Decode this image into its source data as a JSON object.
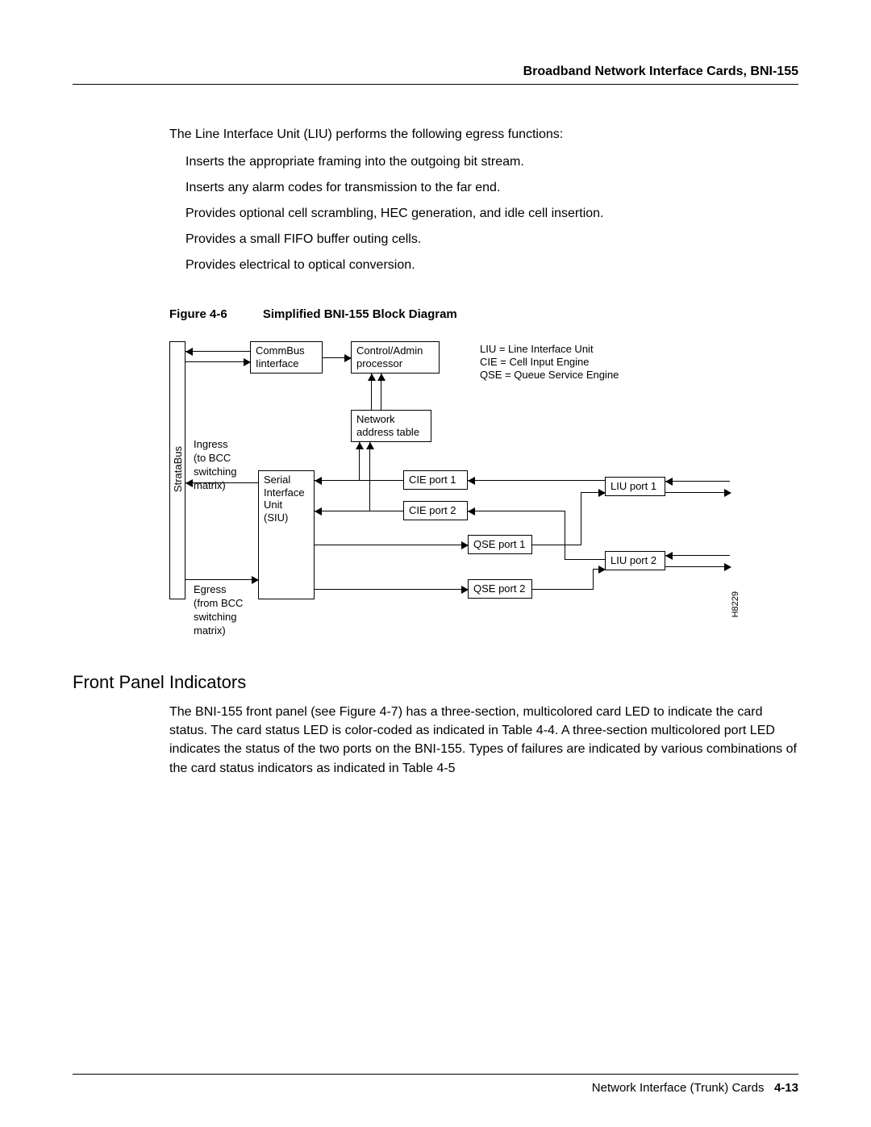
{
  "header": {
    "title": "Broadband Network Interface Cards, BNI-155"
  },
  "intro": "The Line Interface Unit (LIU) performs the following egress functions:",
  "bullets": [
    "Inserts the appropriate framing into the outgoing bit stream.",
    "Inserts any alarm codes for transmission to the far end.",
    "Provides optional cell scrambling, HEC generation, and idle cell insertion.",
    "Provides a small FIFO buffer outing cells.",
    "Provides electrical to optical conversion."
  ],
  "figure": {
    "number": "Figure 4-6",
    "title": "Simplified BNI-155 Block Diagram"
  },
  "diagram": {
    "stratabus": "StrataBus",
    "commbus": "CommBus\nIinterface",
    "control": "Control/Admin\nprocessor",
    "nat": "Network\naddress table",
    "siu": "Serial\nInterface\nUnit\n(SIU)",
    "cie1": "CIE port 1",
    "cie2": "CIE port 2",
    "qse1": "QSE port 1",
    "qse2": "QSE port 2",
    "liu1": "LIU port 1",
    "liu2": "LIU port 2",
    "ingress": "Ingress\n(to BCC\nswitching\nmatrix)",
    "egress": "Egress\n(from BCC\nswitching\nmatrix)",
    "legend1": "LIU = Line Interface Unit",
    "legend2": "CIE = Cell Input Engine",
    "legend3": "QSE = Queue Service Engine",
    "code": "H8229"
  },
  "section": {
    "heading": "Front Panel Indicators",
    "body": "The BNI-155 front panel (see Figure 4-7) has a three-section, multicolored  card  LED to indicate the card status. The card status LED is color-coded as indicated in Table 4-4.  A three-section multicolored  port  LED indicates the status of the two ports on the BNI-155. Types of failures are indicated by various combinations of the card status indicators as indicated in Table 4-5"
  },
  "footer": {
    "text": "Network Interface (Trunk) Cards",
    "page": "4-13"
  }
}
